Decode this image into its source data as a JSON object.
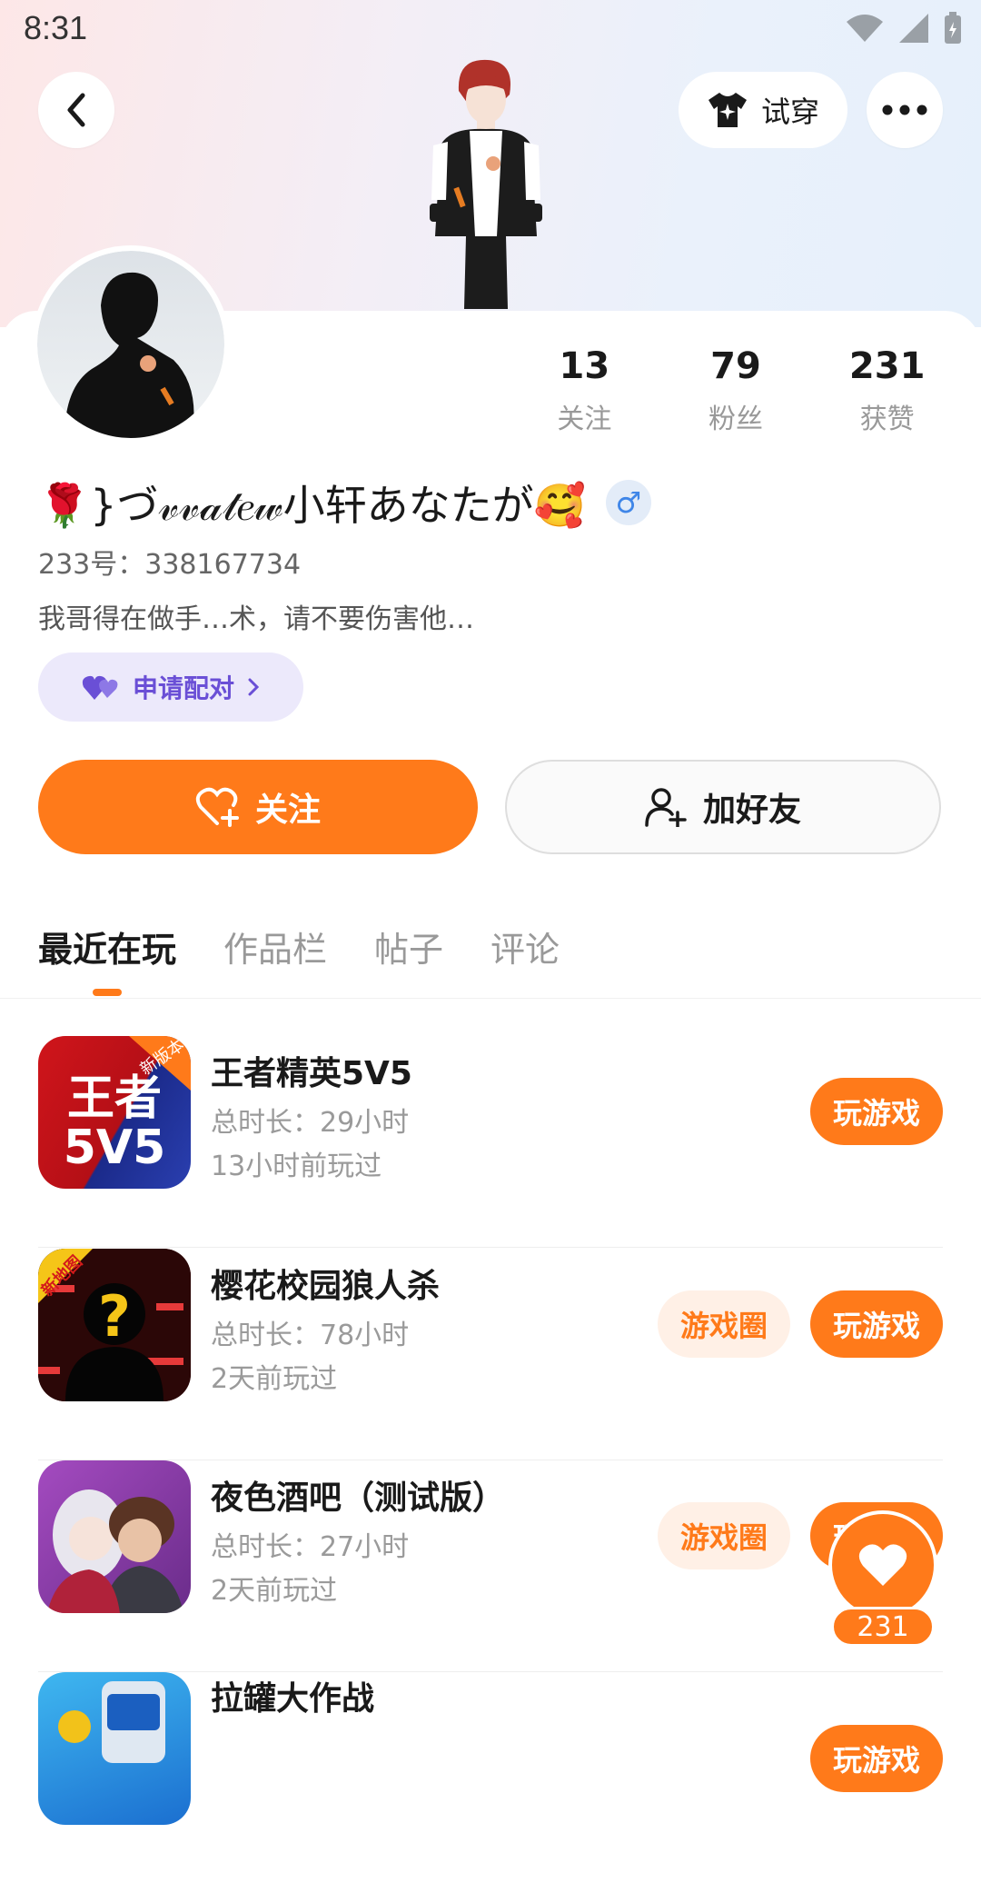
{
  "status_bar": {
    "time": "8:31"
  },
  "header": {
    "try_on_label": "试穿"
  },
  "profile": {
    "stats": [
      {
        "value": "13",
        "label": "关注"
      },
      {
        "value": "79",
        "label": "粉丝"
      },
      {
        "value": "231",
        "label": "获赞"
      }
    ],
    "nickname": "🌹}づ𝓋𝓋𝒶𝓉𝑒𝓌小轩あなたが🥰",
    "gender_symbol": "♂",
    "uid": "233号：338167734",
    "bio": "我哥得在做手…术，请不要伤害他…",
    "pair_label": "申请配对"
  },
  "actions": {
    "follow_label": "关注",
    "add_friend_label": "加好友"
  },
  "tabs": [
    {
      "label": "最近在玩",
      "active": true
    },
    {
      "label": "作品栏",
      "active": false
    },
    {
      "label": "帖子",
      "active": false
    },
    {
      "label": "评论",
      "active": false
    }
  ],
  "games": [
    {
      "title": "王者精英5V5",
      "duration": "总时长：29小时",
      "last_played": "13小时前玩过",
      "icon_text": "王者\n5V5",
      "icon_badge": "新版本",
      "has_circle": false
    },
    {
      "title": "樱花校园狼人杀",
      "duration": "总时长：78小时",
      "last_played": "2天前玩过",
      "icon_text": "?",
      "icon_badge": "新地图",
      "has_circle": true
    },
    {
      "title": "夜色酒吧（测试版）",
      "duration": "总时长：27小时",
      "last_played": "2天前玩过",
      "icon_text": "",
      "icon_badge": "",
      "has_circle": true
    },
    {
      "title": "拉罐大作战",
      "duration": "",
      "last_played": "",
      "icon_text": "",
      "icon_badge": "",
      "has_circle": false
    }
  ],
  "buttons": {
    "play_label": "玩游戏",
    "circle_label": "游戏圈"
  },
  "like_fab": {
    "count": "231"
  },
  "colors": {
    "accent": "#ff7a1a",
    "pair_purple": "#6a4fd6",
    "gender_blue": "#3f86e8"
  }
}
